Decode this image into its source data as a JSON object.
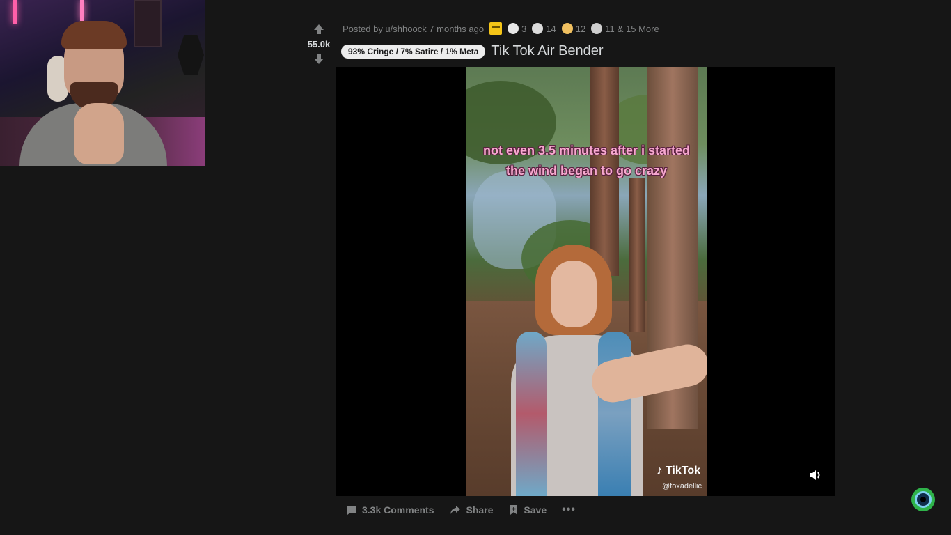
{
  "post": {
    "score": "55.0k",
    "posted_by": "Posted by u/shhoock 7 months ago",
    "awards": [
      {
        "name": "rocket-like-award",
        "count": "3",
        "color": "#e8e8e8"
      },
      {
        "name": "wholesome-award",
        "count": "14",
        "color": "#dcdcdc"
      },
      {
        "name": "helpful-award",
        "count": "12",
        "color": "#f0c060"
      },
      {
        "name": "silver-award",
        "count": "11",
        "color": "#cfcfcf"
      }
    ],
    "awards_more": "& 15 More",
    "flair": "93% Cringe / 7% Satire / 1% Meta",
    "title": "Tik Tok Air Bender"
  },
  "video": {
    "caption": "not even 3.5 minutes after i started the wind began to go crazy",
    "brand": "TikTok",
    "handle": "@foxadellic"
  },
  "actions": {
    "comments": "3.3k Comments",
    "share": "Share",
    "save": "Save",
    "more": "•••"
  },
  "colors": {
    "background": "#161616",
    "text": "#d7dadc",
    "muted": "#818384",
    "caption_pink": "#f7a8cf",
    "gold": "#f5c518"
  }
}
